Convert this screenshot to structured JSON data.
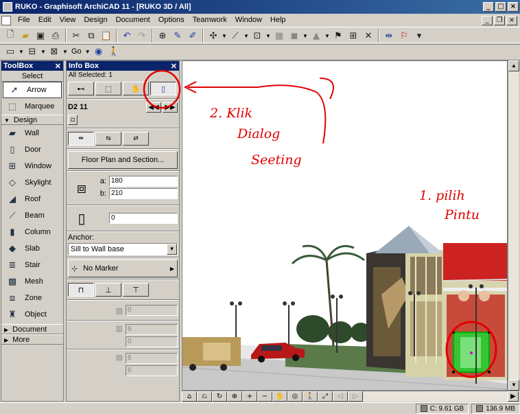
{
  "window": {
    "title": "RUKO - Graphisoft ArchiCAD 11 - [RUKO 3D / All]",
    "controls": [
      "_",
      "□",
      "×"
    ],
    "mdi_controls": [
      "_",
      "❐",
      "×"
    ]
  },
  "menu": [
    "File",
    "Edit",
    "View",
    "Design",
    "Document",
    "Options",
    "Teamwork",
    "Window",
    "Help"
  ],
  "toolbar2": {
    "go_label": "Go"
  },
  "toolbox": {
    "title": "ToolBox",
    "select_section": "Select",
    "tools_select": [
      {
        "label": "Arrow",
        "icon": "arrow-icon"
      },
      {
        "label": "Marquee",
        "icon": "marquee-icon"
      }
    ],
    "design_section": "Design",
    "tools_design": [
      {
        "label": "Wall",
        "icon": "wall-icon"
      },
      {
        "label": "Door",
        "icon": "door-icon"
      },
      {
        "label": "Window",
        "icon": "window-icon"
      },
      {
        "label": "Skylight",
        "icon": "skylight-icon"
      },
      {
        "label": "Roof",
        "icon": "roof-icon"
      },
      {
        "label": "Beam",
        "icon": "beam-icon"
      },
      {
        "label": "Column",
        "icon": "column-icon"
      },
      {
        "label": "Slab",
        "icon": "slab-icon"
      },
      {
        "label": "Stair",
        "icon": "stair-icon"
      },
      {
        "label": "Mesh",
        "icon": "mesh-icon"
      },
      {
        "label": "Zone",
        "icon": "zone-icon"
      },
      {
        "label": "Object",
        "icon": "object-icon"
      }
    ],
    "document_section": "Document",
    "more_section": "More"
  },
  "infobox": {
    "title": "Info Box",
    "selection": "All Selected: 1",
    "element_name": "D2 11",
    "floor_plan_button": "Floor Plan and Section...",
    "a_label": "a:",
    "a_value": "180",
    "b_label": "b:",
    "b_value": "210",
    "sill_value": "0",
    "anchor_label": "Anchor:",
    "anchor_value": "Sill to Wall base",
    "marker_label": "No Marker",
    "dim_values": [
      "0",
      "6",
      "0",
      "6",
      "6"
    ]
  },
  "annotations": {
    "step2": [
      "2. Klik",
      "Dialog",
      "Seeting"
    ],
    "step1": [
      "1. pilih",
      "Pintu"
    ],
    "color": "#e00000"
  },
  "status": {
    "disk": "C: 9.61 GB",
    "memory": "136.9 MB"
  }
}
